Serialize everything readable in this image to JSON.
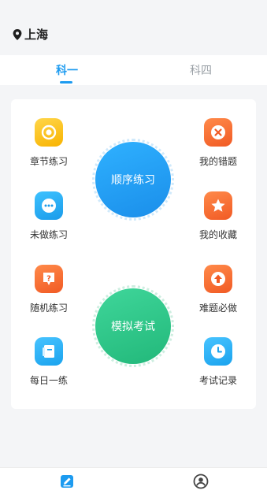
{
  "header": {
    "city": "上海"
  },
  "tabs": [
    {
      "label": "科一",
      "active": true
    },
    {
      "label": "科四",
      "active": false
    }
  ],
  "left_items": [
    {
      "label": "章节练习",
      "icon": "ring-icon"
    },
    {
      "label": "未做练习",
      "icon": "chat-dots-icon"
    },
    {
      "label": "随机练习",
      "icon": "question-icon"
    },
    {
      "label": "每日一练",
      "icon": "notebook-icon"
    }
  ],
  "right_items": [
    {
      "label": "我的错题",
      "icon": "close-circle-icon"
    },
    {
      "label": "我的收藏",
      "icon": "star-icon"
    },
    {
      "label": "难题必做",
      "icon": "arrow-up-icon"
    },
    {
      "label": "考试记录",
      "icon": "clock-icon"
    }
  ],
  "main_buttons": {
    "order_practice": "顺序练习",
    "mock_exam": "模拟考试"
  },
  "bottom_nav": [
    {
      "icon": "edit-icon",
      "active": true
    },
    {
      "icon": "profile-icon",
      "active": false
    }
  ],
  "colors": {
    "accent": "#1d9bf0",
    "green": "#22b87a",
    "orange": "#f15a24",
    "yellow": "#f8b300"
  }
}
